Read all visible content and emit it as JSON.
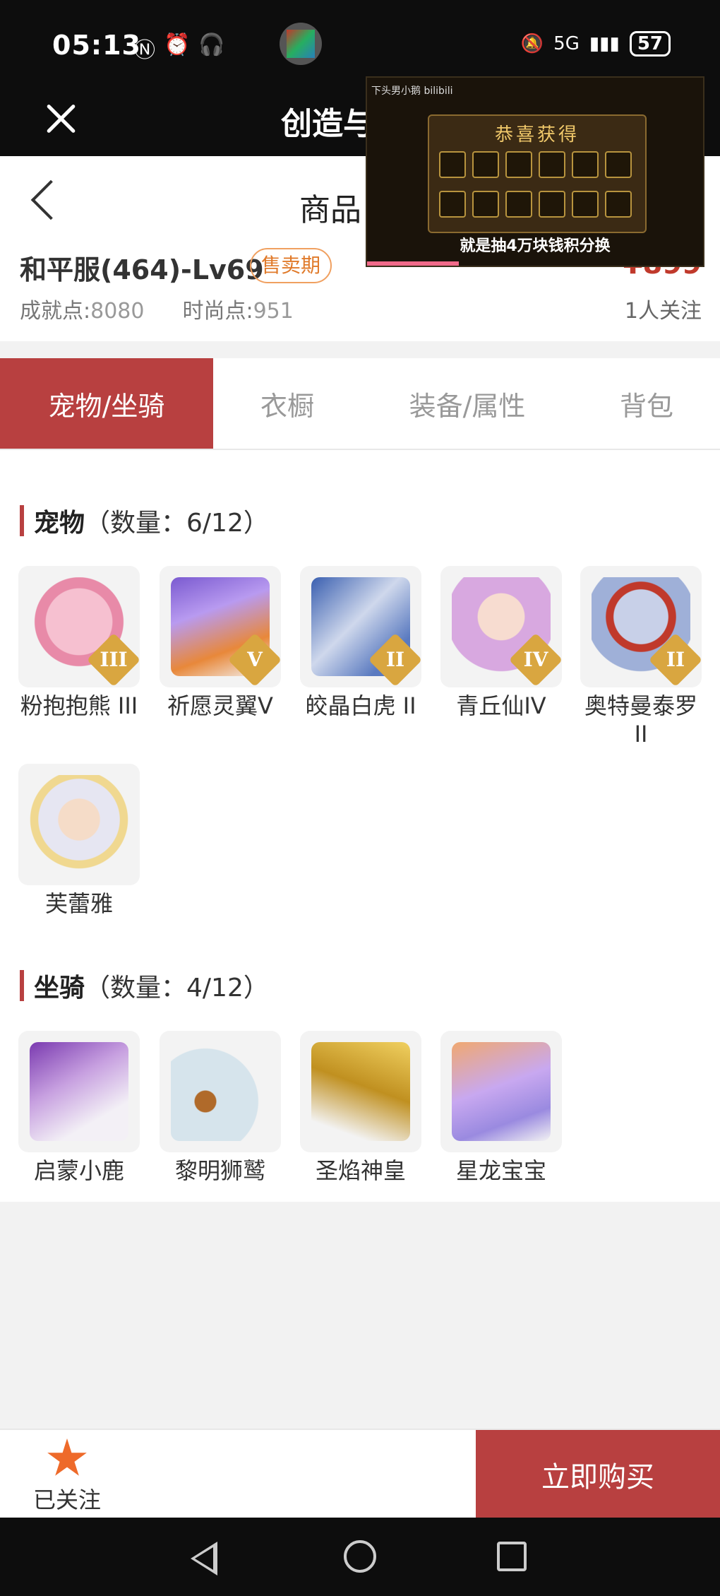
{
  "status_bar": {
    "time": "05:13",
    "battery": "57",
    "network": "5G"
  },
  "web_topbar": {
    "title": "创造与"
  },
  "video_overlay": {
    "uploader": "下头男小鹅 bilibili",
    "panel_title": "恭喜获得",
    "caption": "就是抽4万块钱积分换",
    "progress": 0.27
  },
  "header": {
    "page_title": "商品",
    "server": "和平服(464)-Lv69",
    "status_badge": "售卖期",
    "price": "¥899",
    "achievement_label": "成就点:",
    "achievement_value": "8080",
    "fashion_label": "时尚点:",
    "fashion_value": "951",
    "followers": "1人关注"
  },
  "tabs": [
    {
      "label": "宠物/坐骑",
      "active": true
    },
    {
      "label": "衣橱",
      "active": false
    },
    {
      "label": "装备/属性",
      "active": false
    },
    {
      "label": "背包",
      "active": false
    }
  ],
  "pets": {
    "title": "宠物",
    "count": "（数量：6/12）",
    "items": [
      {
        "name": "粉抱抱熊 III",
        "tier": "III",
        "color": "#f2a0b8"
      },
      {
        "name": "祈愿灵翼V",
        "tier": "V",
        "color": "#8a6ad8"
      },
      {
        "name": "皎晶白虎 II",
        "tier": "II",
        "color": "#6a8fcf"
      },
      {
        "name": "青丘仙IV",
        "tier": "IV",
        "color": "#d8a8e0"
      },
      {
        "name": "奥特曼泰罗 II",
        "tier": "II",
        "color": "#9fb0d8"
      },
      {
        "name": "芙蕾雅",
        "tier": "",
        "color": "#f0d890"
      }
    ]
  },
  "mounts": {
    "title": "坐骑",
    "count": "（数量：4/12）",
    "items": [
      {
        "name": "启蒙小鹿",
        "color": "#c7a0e0"
      },
      {
        "name": "黎明狮鹫",
        "color": "#d6e4ec"
      },
      {
        "name": "圣焰神皇",
        "color": "#e0c050"
      },
      {
        "name": "星龙宝宝",
        "color": "#c8a8f0"
      }
    ]
  },
  "bottom_bar": {
    "follow_label": "已关注",
    "buy_label": "立即购买"
  }
}
